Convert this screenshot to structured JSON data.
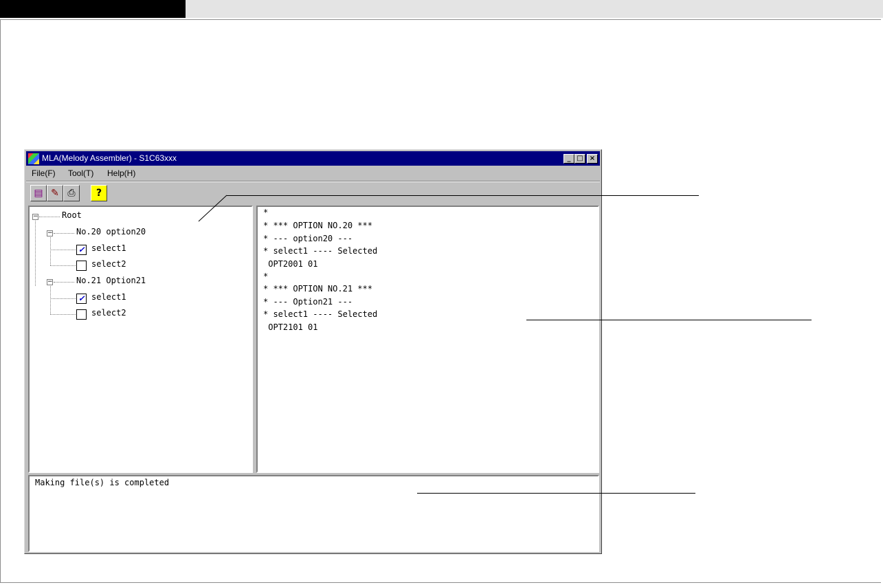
{
  "window": {
    "title": "MLA(Melody Assembler) - S1C63xxx",
    "controls": {
      "minimize": "_",
      "maximize": "□",
      "close": "×"
    }
  },
  "menu": [
    {
      "label": "File(F)"
    },
    {
      "label": "Tool(T)"
    },
    {
      "label": "Help(H)"
    }
  ],
  "toolbar": [
    {
      "icon": "make-file-icon",
      "glyph": "▤"
    },
    {
      "icon": "edit-icon",
      "glyph": "✎"
    },
    {
      "icon": "print-icon",
      "glyph": "⎙"
    },
    {
      "icon": "help-icon",
      "glyph": "?"
    }
  ],
  "tree": {
    "root": "Root",
    "options": [
      {
        "label": "No.20 option20",
        "selects": [
          {
            "label": "select1",
            "checked": true,
            "mark": "✓"
          },
          {
            "label": "select2",
            "checked": false,
            "mark": ""
          }
        ]
      },
      {
        "label": "No.21 Option21",
        "selects": [
          {
            "label": "select1",
            "checked": true,
            "mark": "✓"
          },
          {
            "label": "select2",
            "checked": false,
            "mark": ""
          }
        ]
      }
    ]
  },
  "output": [
    "*",
    "* *** OPTION NO.20 ***",
    "* --- option20 ---",
    "* select1 ---- Selected",
    " OPT2001 01",
    "*",
    "* *** OPTION NO.21 ***",
    "* --- Option21 ---",
    "* select1 ---- Selected",
    " OPT2101 01"
  ],
  "status_message": "Making file(s) is completed",
  "colors": {
    "titlebar": "#000080",
    "window_face": "#c0c0c0",
    "checkmark": "#0000cc"
  }
}
